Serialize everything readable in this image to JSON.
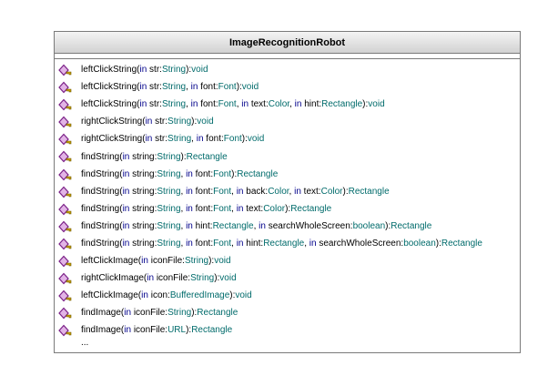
{
  "class_name": "ImageRecognitionRobot",
  "operations": [
    {
      "name": "leftClickString",
      "params": [
        {
          "dir": "in",
          "name": "str",
          "type": "String"
        }
      ],
      "ret": "void"
    },
    {
      "name": "leftClickString",
      "params": [
        {
          "dir": "in",
          "name": "str",
          "type": "String"
        },
        {
          "dir": "in",
          "name": "font",
          "type": "Font"
        }
      ],
      "ret": "void"
    },
    {
      "name": "leftClickString",
      "params": [
        {
          "dir": "in",
          "name": "str",
          "type": "String"
        },
        {
          "dir": "in",
          "name": "font",
          "type": "Font"
        },
        {
          "dir": "in",
          "name": "text",
          "type": "Color"
        },
        {
          "dir": "in",
          "name": "hint",
          "type": "Rectangle"
        }
      ],
      "ret": "void"
    },
    {
      "name": "rightClickString",
      "params": [
        {
          "dir": "in",
          "name": "str",
          "type": "String"
        }
      ],
      "ret": "void"
    },
    {
      "name": "rightClickString",
      "params": [
        {
          "dir": "in",
          "name": "str",
          "type": "String"
        },
        {
          "dir": "in",
          "name": "font",
          "type": "Font"
        }
      ],
      "ret": "void"
    },
    {
      "name": "findString",
      "params": [
        {
          "dir": "in",
          "name": "string",
          "type": "String"
        }
      ],
      "ret": "Rectangle"
    },
    {
      "name": "findString",
      "params": [
        {
          "dir": "in",
          "name": "string",
          "type": "String"
        },
        {
          "dir": "in",
          "name": "font",
          "type": "Font"
        }
      ],
      "ret": "Rectangle"
    },
    {
      "name": "findString",
      "params": [
        {
          "dir": "in",
          "name": "string",
          "type": "String"
        },
        {
          "dir": "in",
          "name": "font",
          "type": "Font"
        },
        {
          "dir": "in",
          "name": "back",
          "type": "Color"
        },
        {
          "dir": "in",
          "name": "text",
          "type": "Color"
        }
      ],
      "ret": "Rectangle"
    },
    {
      "name": "findString",
      "params": [
        {
          "dir": "in",
          "name": "string",
          "type": "String"
        },
        {
          "dir": "in",
          "name": "font",
          "type": "Font"
        },
        {
          "dir": "in",
          "name": "text",
          "type": "Color"
        }
      ],
      "ret": "Rectangle"
    },
    {
      "name": "findString",
      "params": [
        {
          "dir": "in",
          "name": "string",
          "type": "String"
        },
        {
          "dir": "in",
          "name": "hint",
          "type": "Rectangle"
        },
        {
          "dir": "in",
          "name": "searchWholeScreen",
          "type": "boolean"
        }
      ],
      "ret": "Rectangle"
    },
    {
      "name": "findString",
      "params": [
        {
          "dir": "in",
          "name": "string",
          "type": "String"
        },
        {
          "dir": "in",
          "name": "font",
          "type": "Font"
        },
        {
          "dir": "in",
          "name": "hint",
          "type": "Rectangle"
        },
        {
          "dir": "in",
          "name": "searchWholeScreen",
          "type": "boolean"
        }
      ],
      "ret": "Rectangle"
    },
    {
      "name": "leftClickImage",
      "params": [
        {
          "dir": "in",
          "name": "iconFile",
          "type": "String"
        }
      ],
      "ret": "void"
    },
    {
      "name": "rightClickImage",
      "params": [
        {
          "dir": "in",
          "name": "iconFile",
          "type": "String"
        }
      ],
      "ret": "void"
    },
    {
      "name": "leftClickImage",
      "params": [
        {
          "dir": "in",
          "name": "icon",
          "type": "BufferedImage"
        }
      ],
      "ret": "void"
    },
    {
      "name": "findImage",
      "params": [
        {
          "dir": "in",
          "name": "iconFile",
          "type": "String"
        }
      ],
      "ret": "Rectangle"
    },
    {
      "name": "findImage",
      "params": [
        {
          "dir": "in",
          "name": "iconFile",
          "type": "URL"
        }
      ],
      "ret": "Rectangle"
    }
  ],
  "ellipsis": "...",
  "icon_name": "public-operation-icon",
  "colors": {
    "keyword": "#00008b",
    "type": "#006b6b",
    "border": "#7a7a7a",
    "icon_fill": "#e2b4e6",
    "icon_stroke": "#7a1f86",
    "icon_key": "#c8a000"
  }
}
